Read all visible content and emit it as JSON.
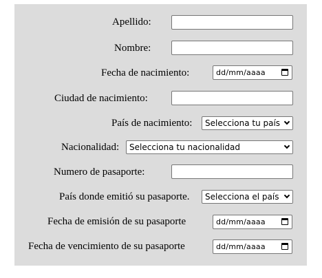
{
  "form": {
    "apellido_label": "Apellido:",
    "nombre_label": "Nombre:",
    "fecha_nacimiento_label": "Fecha de nacimiento:",
    "fecha_nacimiento_value": "dd/mm/aaaa",
    "ciudad_label": "Ciudad de nacimiento:",
    "pais_label": "País de nacimiento:",
    "pais_select": "Selecciona tu país",
    "nacionalidad_label": "Nacionalidad:",
    "nacionalidad_select": "Selecciona tu nacionalidad",
    "pasaporte_label": "Numero de pasaporte:",
    "pais_emision_label": "País donde emitió su pasaporte.",
    "pais_emision_select": "Selecciona el país",
    "fecha_emision_label": "Fecha de emisión de su pasaporte",
    "fecha_emision_value": "dd/mm/aaaa",
    "fecha_venc_label": "Fecha de vencimiento de su pasaporte",
    "fecha_venc_value": "dd/mm/aaaa"
  }
}
